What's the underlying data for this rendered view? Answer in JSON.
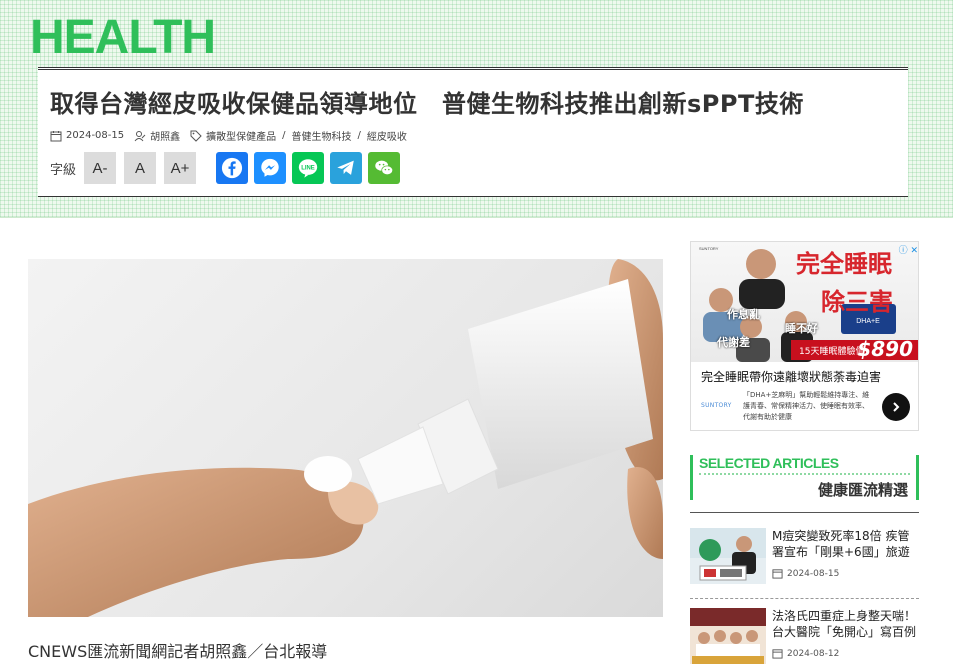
{
  "brand": "HEALTH",
  "article": {
    "title": "取得台灣經皮吸收保健品領導地位　普健生物科技推出創新sPPT技術",
    "date": "2024-08-15",
    "author": "胡照鑫",
    "tags": [
      "擴散型保健產品",
      "普健生物科技",
      "經皮吸收"
    ],
    "font_size_label": "字級",
    "font_buttons": [
      "A-",
      "A",
      "A+"
    ],
    "byline": "CNEWS匯流新聞網記者胡照鑫／台北報導"
  },
  "share": [
    {
      "name": "facebook",
      "color": "#1877f2"
    },
    {
      "name": "messenger",
      "color": "#1e90ff"
    },
    {
      "name": "line",
      "color": "#06c755"
    },
    {
      "name": "telegram",
      "color": "#2aa2dc"
    },
    {
      "name": "wechat",
      "color": "#55bb33"
    }
  ],
  "ad": {
    "headline1": "完全睡眠",
    "headline2": "除三害",
    "tag1": "作息亂",
    "tag2": "睡不好",
    "tag3": "代謝差",
    "price_bar": "15天睡眠體驗價",
    "price": "$890",
    "close": "ⓘ ✕",
    "title": "完全睡眠帶你遠離壞狀態荼毒迫害",
    "logo": "SUNTORY",
    "desc": "「DHA+芝麻明」幫助輕鬆維持專注、維護青春、常保精神活力、使睡眠有效率、代謝有助於健康"
  },
  "sidebar": {
    "section_en": "SELECTED ARTICLES",
    "section_zh": "健康匯流精選",
    "articles": [
      {
        "title": "M痘突變致死率18倍 疾管署宣布「剛果+6國」旅遊",
        "date": "2024-08-15"
      },
      {
        "title": "法洛氏四重症上身整天喘！台大醫院「免開心」寫百例",
        "date": "2024-08-12"
      }
    ]
  }
}
